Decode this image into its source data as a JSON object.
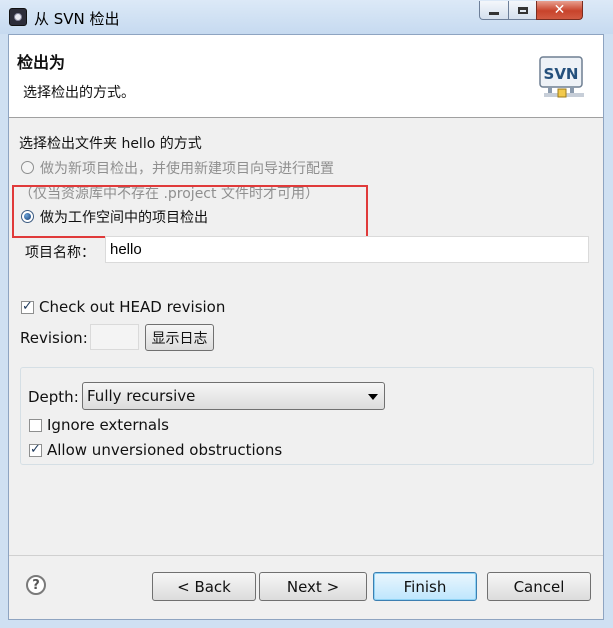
{
  "window": {
    "title": "从 SVN 检出",
    "minimize_glyph": "",
    "maximize_glyph": "",
    "close_glyph": "✕"
  },
  "banner": {
    "title": "检出为",
    "description": "选择检出的方式。",
    "logo_text": "SVN"
  },
  "checkout": {
    "section_label": "选择检出文件夹 hello 的方式",
    "option_new_project": "做为新项目检出，并使用新建项目向导进行配置",
    "option_new_project_note": "（仅当资源库中不存在 .project 文件时才可用）",
    "option_workspace_project": "做为工作空间中的项目检出",
    "selected_option": "option_workspace_project"
  },
  "project_name": {
    "label": "项目名称：",
    "value": "hello"
  },
  "revision": {
    "head_checkbox_label": "Check out HEAD revision",
    "head_checked": true,
    "revision_label": "Revision:",
    "revision_value": "",
    "show_log_button": "显示日志"
  },
  "depth": {
    "label": "Depth:",
    "selected": "Fully recursive",
    "ignore_externals_label": "Ignore externals",
    "ignore_externals_checked": false,
    "allow_unversioned_label": "Allow unversioned obstructions",
    "allow_unversioned_checked": true
  },
  "footer": {
    "help_glyph": "?",
    "back_button": "< Back",
    "next_button": "Next >",
    "finish_button": "Finish",
    "cancel_button": "Cancel"
  },
  "colors": {
    "highlight_border": "#e03a3a",
    "window_frame": "#cfe0f2",
    "dialog_background": "#f0f0f0"
  }
}
